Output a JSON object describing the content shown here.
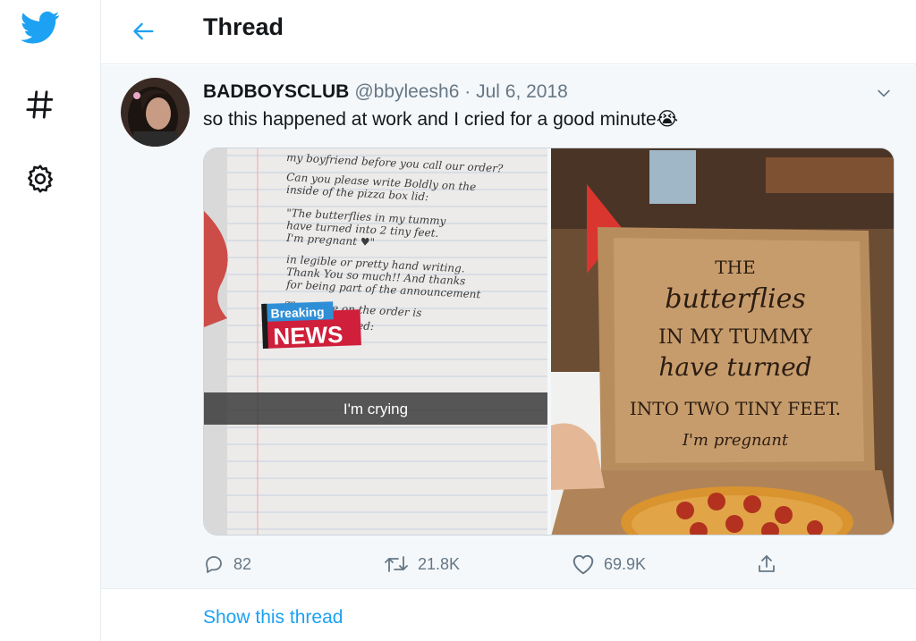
{
  "app": {
    "brand_color": "#1da1f2",
    "text_color": "#14171a",
    "muted_color": "#657786"
  },
  "sidebar": {
    "items": [
      {
        "icon": "twitter-bird-icon"
      },
      {
        "icon": "hashtag-explore-icon"
      },
      {
        "icon": "gear-settings-icon"
      }
    ]
  },
  "header": {
    "title": "Thread",
    "back_icon": "arrow-left-icon"
  },
  "tweet": {
    "display_name": "BADBOYSCLUB",
    "handle": "@bbyleesh6",
    "separator": "·",
    "date": "Jul 6, 2018",
    "text": "so this happened at work and I cried for a good minute😭",
    "media": {
      "left_photo": {
        "breaking": "Breaking",
        "news": "NEWS",
        "caption": "I'm crying",
        "note_lines": [
          "my boyfriend before you call our order?",
          "Can you please write Boldly on the",
          "inside of the pizza box lid:",
          "\"The butterflies in my tummy",
          "have turned into 2 tiny feet.",
          "I'm pregnant ♥\"",
          "in legible or pretty hand writing.",
          "Thank You so much!! And thanks",
          "for being part of the announcement",
          "The name on the order is",
          "and we ordered:"
        ]
      },
      "right_photo": {
        "box_lines": [
          "THE",
          "butterflies",
          "IN MY TUMMY",
          "have turned",
          "INTO TWO TINY FEET.",
          "I'm pregnant"
        ]
      }
    },
    "actions": {
      "replies": "82",
      "retweets": "21.8K",
      "likes": "69.9K"
    }
  },
  "footer": {
    "show_thread": "Show this thread"
  }
}
